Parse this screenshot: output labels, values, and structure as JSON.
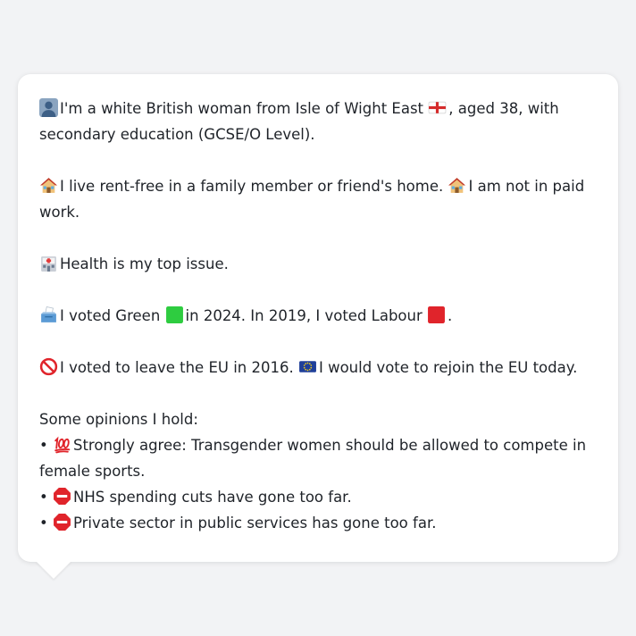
{
  "profile": {
    "identity_line1": "I'm a white British woman from Isle of Wight East",
    "identity_line1b": ", aged 38, with",
    "identity_line2": "secondary education (GCSE/O Level).",
    "housing": "I live rent-free in a family member or friend's home.",
    "work": "I am not in paid work.",
    "top_issue": "Health is my top issue.",
    "vote_a": "I voted Green",
    "vote_b": "in 2024. In 2019, I voted Labour",
    "vote_c": ".",
    "brexit_a": "I voted to leave the EU in 2016.",
    "brexit_b": "I would vote to rejoin the EU today.",
    "opinions_heading": "Some opinions I hold:",
    "opinions": [
      {
        "bullet": "•",
        "icon": "hundred-points-icon",
        "text": "Strongly agree: Transgender women should be allowed to compete in female sports."
      },
      {
        "bullet": "•",
        "icon": "stop-sign-icon",
        "text": "NHS spending cuts have gone too far."
      },
      {
        "bullet": "•",
        "icon": "stop-sign-icon",
        "text": "Private sector in public services has gone too far."
      }
    ]
  },
  "icons": {
    "person": "person-silhouette-icon",
    "flag": "england-flag-icon",
    "house": "house-icon",
    "hospital": "hospital-icon",
    "ballot": "ballot-box-icon",
    "green_square": "green-square-icon",
    "red_square": "red-square-icon",
    "no_entry": "prohibited-icon",
    "eu_flag": "eu-flag-icon"
  },
  "colors": {
    "background": "#f2f3f5",
    "card": "#ffffff",
    "text": "#1f2329",
    "green": "#2ecc40",
    "red": "#e0242b",
    "eu_blue": "#1f3f99"
  }
}
